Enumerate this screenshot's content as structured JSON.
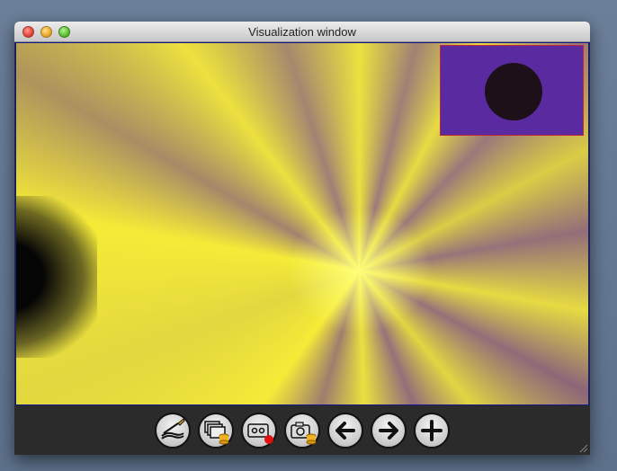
{
  "window": {
    "title": "Visualization window"
  },
  "toolbar": {
    "buttons": [
      {
        "name": "reset-view-button",
        "icon": "brush-icon"
      },
      {
        "name": "save-layers-button",
        "icon": "layers-database-icon"
      },
      {
        "name": "record-button",
        "icon": "tape-record-icon"
      },
      {
        "name": "snapshot-button",
        "icon": "camera-database-icon"
      },
      {
        "name": "back-button",
        "icon": "arrow-left-icon"
      },
      {
        "name": "forward-button",
        "icon": "arrow-right-icon"
      },
      {
        "name": "add-button",
        "icon": "plus-icon"
      }
    ]
  },
  "colors": {
    "canvas_border": "#111a8a",
    "inset_background": "#5a2aa0",
    "inset_border": "#c0283a",
    "starburst": "#f0e63c",
    "toolbar_background": "#2b2b2b"
  }
}
